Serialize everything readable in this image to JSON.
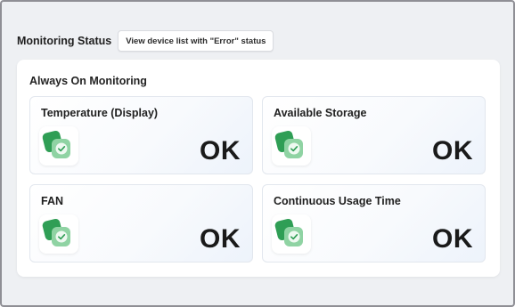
{
  "header": {
    "title": "Monitoring Status",
    "error_button_label": "View device list with \"Error\" status"
  },
  "panel": {
    "title": "Always On Monitoring",
    "cards": [
      {
        "title": "Temperature (Display)",
        "status": "OK",
        "icon": "status-ok-icon"
      },
      {
        "title": "Available Storage",
        "status": "OK",
        "icon": "status-ok-icon"
      },
      {
        "title": "FAN",
        "status": "OK",
        "icon": "status-ok-icon"
      },
      {
        "title": "Continuous Usage Time",
        "status": "OK",
        "icon": "status-ok-icon"
      }
    ]
  },
  "colors": {
    "ok_dark": "#2f9e55",
    "ok_light": "#8fd3a3"
  }
}
